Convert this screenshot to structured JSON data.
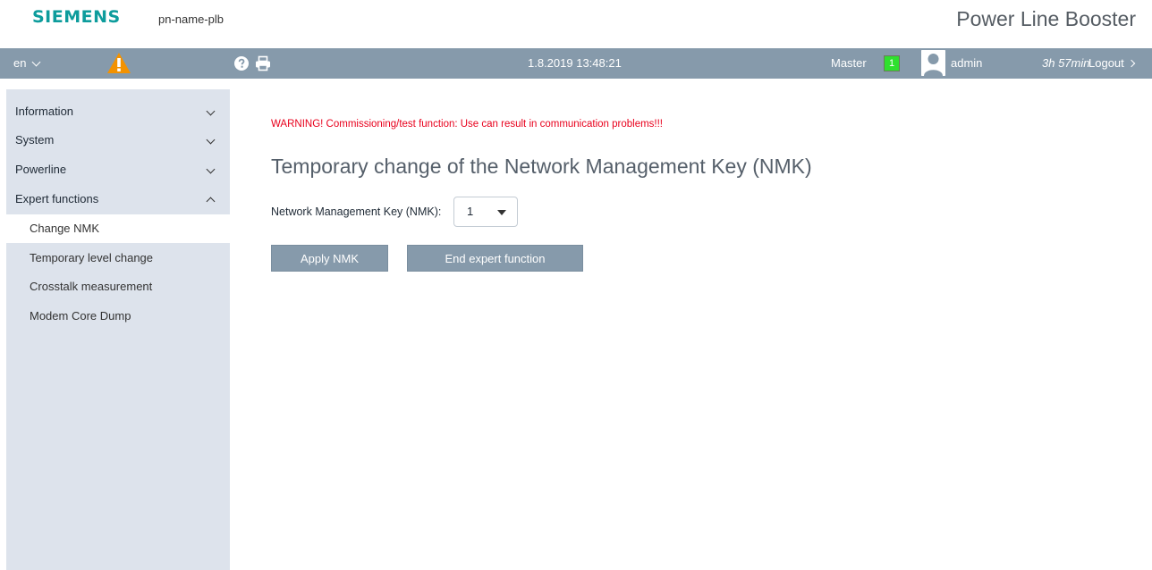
{
  "header": {
    "brand": "SIEMENS",
    "device_name": "pn-name-plb",
    "product_title": "Power Line Booster"
  },
  "toolbar": {
    "language": "en",
    "icons": {
      "warning": "warning-triangle-icon",
      "help": "help-icon",
      "print": "print-icon",
      "user": "user-avatar-icon"
    },
    "datetime": "1.8.2019 13:48:21",
    "role_label": "Master",
    "role_badge": "1",
    "user": "admin",
    "session_time": "3h 57min",
    "logout": "Logout"
  },
  "sidebar": {
    "items": [
      {
        "label": "Information",
        "expanded": false
      },
      {
        "label": "System",
        "expanded": false
      },
      {
        "label": "Powerline",
        "expanded": false
      },
      {
        "label": "Expert functions",
        "expanded": true
      }
    ],
    "subitems": [
      {
        "label": "Change NMK",
        "active": true
      },
      {
        "label": "Temporary level change",
        "active": false
      },
      {
        "label": "Crosstalk measurement",
        "active": false
      },
      {
        "label": "Modem Core Dump",
        "active": false
      }
    ]
  },
  "main": {
    "warning": "WARNING! Commissioning/test function: Use can result in communication problems!!!",
    "heading": "Temporary change of the Network Management Key (NMK)",
    "nmk_label": "Network Management Key (NMK):",
    "nmk_value": "1",
    "apply_button": "Apply NMK",
    "end_button": "End expert function"
  },
  "colors": {
    "brand": "#0d9c9c",
    "toolbar": "#869aab",
    "sidebar": "#dde3ec",
    "warning_text": "#e8001c",
    "warning_icon": "#f39200",
    "role_badge": "#2fe02f"
  }
}
